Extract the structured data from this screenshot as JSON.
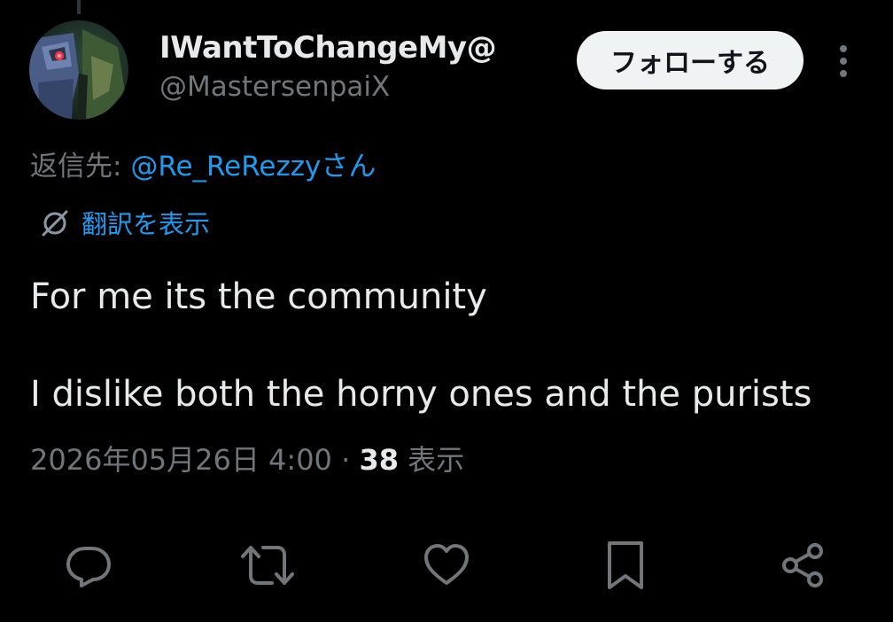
{
  "post": {
    "author": {
      "display_name": "IWantToChangeMy@",
      "handle": "@MastersenpaiX",
      "avatar_icon": "avatar-robot-character-icon"
    },
    "follow_label": "フォローする",
    "more_icon": "more-vertical-icon",
    "reply_to": {
      "prefix": "返信先: ",
      "mention": "@Re_ReRezzy",
      "suffix": "さん"
    },
    "translate": {
      "icon": "translate-icon",
      "label": "翻訳を表示"
    },
    "text_lines": [
      "For me its the community",
      "I dislike both the horny ones and the purists"
    ],
    "meta": {
      "timestamp": "2026年05月26日 4:00",
      "separator": " · ",
      "views_count": "38",
      "views_label": " 表示"
    }
  },
  "actions": [
    {
      "name": "reply",
      "icon": "reply-icon"
    },
    {
      "name": "repost",
      "icon": "repost-icon"
    },
    {
      "name": "like",
      "icon": "heart-icon"
    },
    {
      "name": "bookmark",
      "icon": "bookmark-icon"
    },
    {
      "name": "share",
      "icon": "share-icon"
    }
  ],
  "colors": {
    "background": "#000000",
    "primary_text": "#e7e9ea",
    "secondary_text": "#71767b",
    "link": "#1d9bf0",
    "follow_button_bg": "#eff3f4",
    "follow_button_text": "#0f1419"
  }
}
